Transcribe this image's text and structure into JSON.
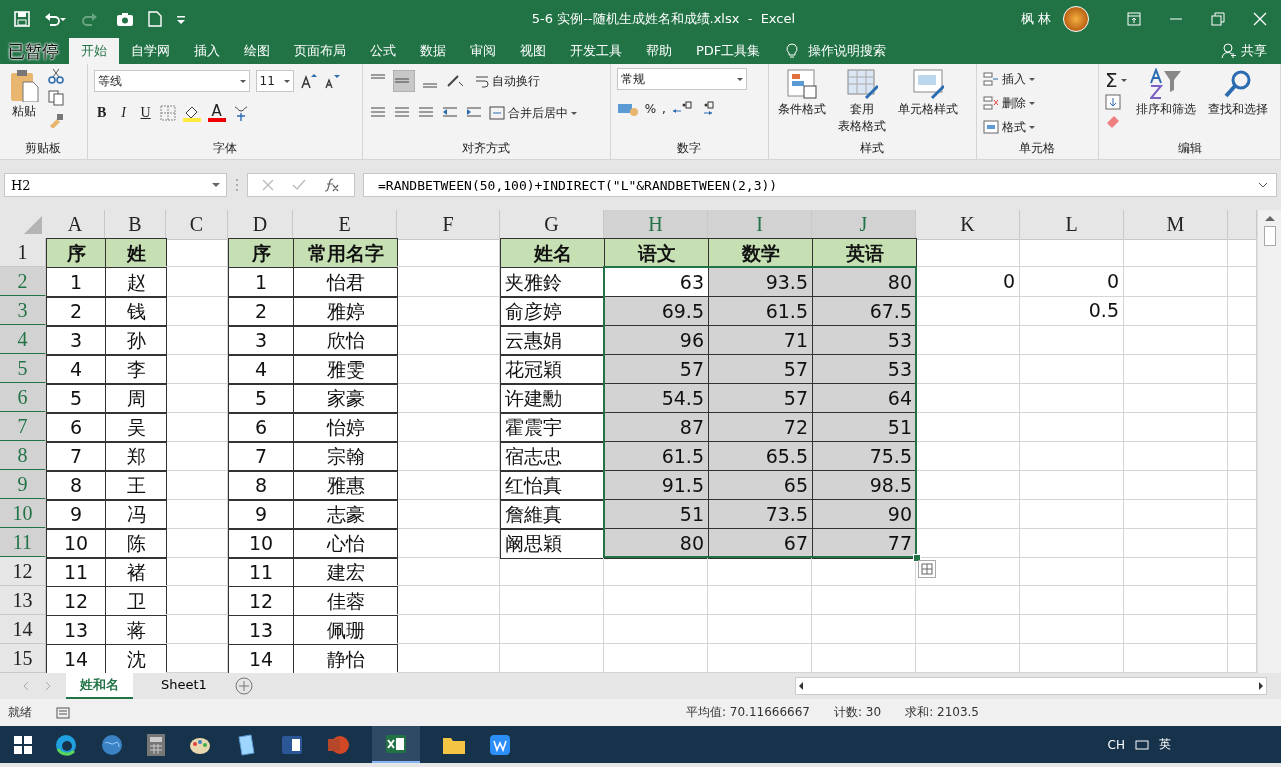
{
  "title_bar": {
    "title": "5-6 实例--随机生成姓名和成绩.xlsx  -  Excel",
    "user": "枫 林"
  },
  "recorder_badge": "已暂停",
  "ribbon_tabs": [
    {
      "label": "开始",
      "selected": true
    },
    {
      "label": "自学网",
      "selected": false
    },
    {
      "label": "插入",
      "selected": false
    },
    {
      "label": "绘图",
      "selected": false
    },
    {
      "label": "页面布局",
      "selected": false
    },
    {
      "label": "公式",
      "selected": false
    },
    {
      "label": "数据",
      "selected": false
    },
    {
      "label": "审阅",
      "selected": false
    },
    {
      "label": "视图",
      "selected": false
    },
    {
      "label": "开发工具",
      "selected": false
    },
    {
      "label": "帮助",
      "selected": false
    },
    {
      "label": "PDF工具集",
      "selected": false
    }
  ],
  "tell_me": "操作说明搜索",
  "share": "共享",
  "ribbon": {
    "clipboard": {
      "paste": "粘贴",
      "label": "剪贴板"
    },
    "font": {
      "font_name": "等线",
      "font_size": "11",
      "format_buttons": [
        "B",
        "I",
        "U"
      ],
      "font_color_letter": "A",
      "label": "字体"
    },
    "alignment": {
      "wrap": "自动换行",
      "merge": "合并后居中",
      "label": "对齐方式"
    },
    "number": {
      "format": "常规",
      "percent": "%",
      "comma": ",",
      "label": "数字"
    },
    "styles": {
      "buttons": [
        [
          "条件格式"
        ],
        [
          "套用",
          "表格格式"
        ],
        [
          "单元格样式"
        ]
      ],
      "label": "样式"
    },
    "cells": {
      "buttons": [
        "插入",
        "删除",
        "格式"
      ],
      "label": "单元格"
    },
    "editing": {
      "buttons": [
        "排序和筛选",
        "查找和选择"
      ],
      "sum": "Σ",
      "label": "编辑"
    }
  },
  "formula_bar": {
    "name_box": "H2",
    "formula": "=RANDBETWEEN(50,100)+INDIRECT(\"L\"&RANDBETWEEN(2,3))"
  },
  "columns": [
    {
      "label": "A",
      "selected": false
    },
    {
      "label": "B",
      "selected": false
    },
    {
      "label": "C",
      "selected": false
    },
    {
      "label": "D",
      "selected": false
    },
    {
      "label": "E",
      "selected": false
    },
    {
      "label": "F",
      "selected": false
    },
    {
      "label": "G",
      "selected": false
    },
    {
      "label": "H",
      "selected": true
    },
    {
      "label": "I",
      "selected": true
    },
    {
      "label": "J",
      "selected": true
    },
    {
      "label": "K",
      "selected": false
    },
    {
      "label": "L",
      "selected": false
    },
    {
      "label": "M",
      "selected": false
    }
  ],
  "rows": [
    {
      "header": "1",
      "selected": false,
      "kind": "header",
      "cells": {
        "A": "序",
        "B": "姓",
        "D": "序",
        "E": "常用名字",
        "G": "姓名",
        "H": "语文",
        "I": "数学",
        "J": "英语"
      }
    },
    {
      "header": "2",
      "selected": true,
      "kind": "data",
      "cells": {
        "A": "1",
        "B": "赵",
        "D": "1",
        "E": "怡君",
        "G": "夹雅鈴",
        "H": "63",
        "I": "93.5",
        "J": "80",
        "K": "0",
        "L": "0"
      }
    },
    {
      "header": "3",
      "selected": true,
      "kind": "data",
      "cells": {
        "A": "2",
        "B": "钱",
        "D": "2",
        "E": "雅婷",
        "G": "俞彦婷",
        "H": "69.5",
        "I": "61.5",
        "J": "67.5",
        "L": "0.5"
      }
    },
    {
      "header": "4",
      "selected": true,
      "kind": "data",
      "cells": {
        "A": "3",
        "B": "孙",
        "D": "3",
        "E": "欣怡",
        "G": "云惠娟",
        "H": "96",
        "I": "71",
        "J": "53"
      }
    },
    {
      "header": "5",
      "selected": true,
      "kind": "data",
      "cells": {
        "A": "4",
        "B": "李",
        "D": "4",
        "E": "雅雯",
        "G": "花冠穎",
        "H": "57",
        "I": "57",
        "J": "53"
      }
    },
    {
      "header": "6",
      "selected": true,
      "kind": "data",
      "cells": {
        "A": "5",
        "B": "周",
        "D": "5",
        "E": "家豪",
        "G": "许建勳",
        "H": "54.5",
        "I": "57",
        "J": "64"
      }
    },
    {
      "header": "7",
      "selected": true,
      "kind": "data",
      "cells": {
        "A": "6",
        "B": "吴",
        "D": "6",
        "E": "怡婷",
        "G": "霍震宇",
        "H": "87",
        "I": "72",
        "J": "51"
      }
    },
    {
      "header": "8",
      "selected": true,
      "kind": "data",
      "cells": {
        "A": "7",
        "B": "郑",
        "D": "7",
        "E": "宗翰",
        "G": "宿志忠",
        "H": "61.5",
        "I": "65.5",
        "J": "75.5"
      }
    },
    {
      "header": "9",
      "selected": true,
      "kind": "data",
      "cells": {
        "A": "8",
        "B": "王",
        "D": "8",
        "E": "雅惠",
        "G": "红怡真",
        "H": "91.5",
        "I": "65",
        "J": "98.5"
      }
    },
    {
      "header": "10",
      "selected": true,
      "kind": "data",
      "cells": {
        "A": "9",
        "B": "冯",
        "D": "9",
        "E": "志豪",
        "G": "詹維真",
        "H": "51",
        "I": "73.5",
        "J": "90"
      }
    },
    {
      "header": "11",
      "selected": true,
      "kind": "data",
      "cells": {
        "A": "10",
        "B": "陈",
        "D": "10",
        "E": "心怡",
        "G": "阚思穎",
        "H": "80",
        "I": "67",
        "J": "77"
      }
    },
    {
      "header": "12",
      "selected": false,
      "kind": "data",
      "cells": {
        "A": "11",
        "B": "褚",
        "D": "11",
        "E": "建宏"
      }
    },
    {
      "header": "13",
      "selected": false,
      "kind": "data",
      "cells": {
        "A": "12",
        "B": "卫",
        "D": "12",
        "E": "佳蓉"
      }
    },
    {
      "header": "14",
      "selected": false,
      "kind": "data",
      "cells": {
        "A": "13",
        "B": "蒋",
        "D": "13",
        "E": "佩珊"
      }
    },
    {
      "header": "15",
      "selected": false,
      "kind": "data",
      "cells": {
        "A": "14",
        "B": "沈",
        "D": "14",
        "E": "静怡"
      }
    }
  ],
  "sheet_tabs": [
    {
      "label": "姓和名",
      "selected": true
    },
    {
      "label": "Sheet1",
      "selected": false
    }
  ],
  "status_bar": {
    "mode": "就绪",
    "average": "平均值: 70.11666667",
    "count": "计数: 30",
    "sum": "求和: 2103.5"
  },
  "taskbar": {
    "input_lang": "CH",
    "ime": "英"
  }
}
